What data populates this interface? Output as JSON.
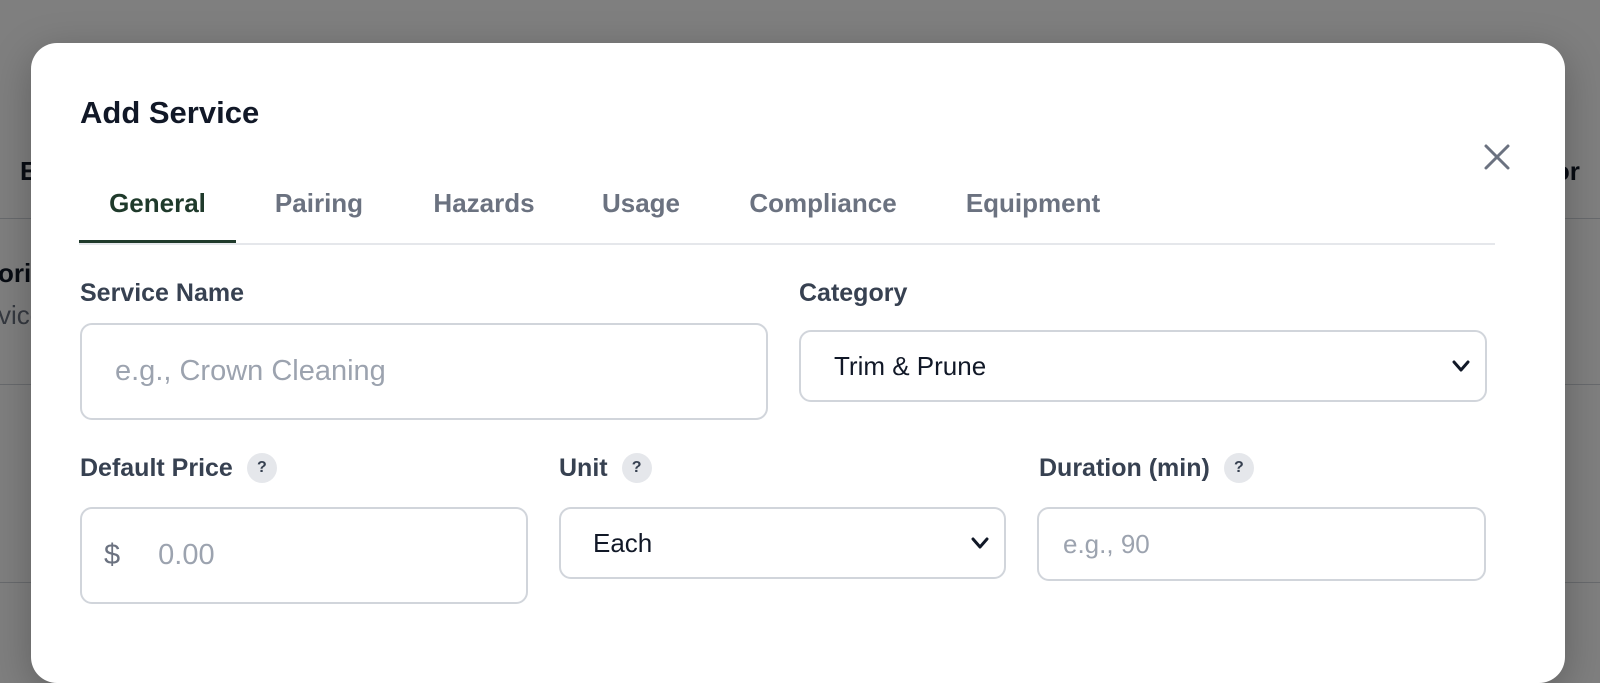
{
  "background": {
    "left_fragment_1": "E",
    "left_fragment_2": "orie",
    "left_fragment_3": "vice",
    "right_fragment": "hor"
  },
  "modal": {
    "title": "Add Service",
    "close_icon": "close-icon"
  },
  "tabs": [
    {
      "label": "General",
      "active": true
    },
    {
      "label": "Pairing",
      "active": false
    },
    {
      "label": "Hazards",
      "active": false
    },
    {
      "label": "Usage",
      "active": false
    },
    {
      "label": "Compliance",
      "active": false
    },
    {
      "label": "Equipment",
      "active": false
    }
  ],
  "form": {
    "service_name": {
      "label": "Service Name",
      "placeholder": "e.g., Crown Cleaning",
      "value": ""
    },
    "category": {
      "label": "Category",
      "selected": "Trim & Prune"
    },
    "default_price": {
      "label": "Default Price",
      "help": "?",
      "prefix": "$",
      "placeholder": "0.00"
    },
    "unit": {
      "label": "Unit",
      "help": "?",
      "selected": "Each"
    },
    "duration": {
      "label": "Duration (min)",
      "help": "?",
      "placeholder": "e.g., 90"
    }
  },
  "colors": {
    "accent": "#1f3a2b",
    "overlay": "#7f7f7f"
  }
}
